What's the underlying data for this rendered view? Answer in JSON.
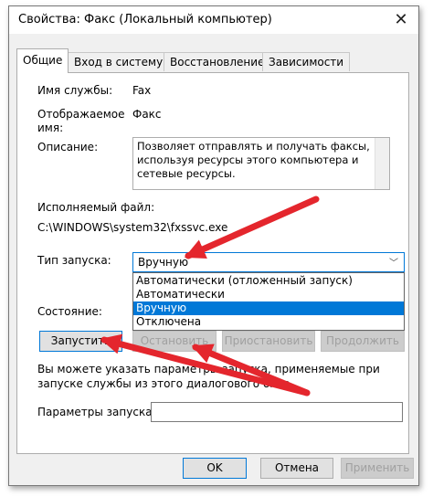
{
  "window": {
    "title": "Свойства: Факс (Локальный компьютер)"
  },
  "tabs": [
    {
      "label": "Общие",
      "active": true
    },
    {
      "label": "Вход в систему",
      "active": false
    },
    {
      "label": "Восстановление",
      "active": false
    },
    {
      "label": "Зависимости",
      "active": false
    }
  ],
  "general": {
    "service_name_label": "Имя службы:",
    "service_name_value": "Fax",
    "display_name_label_line1": "Отображаемое",
    "display_name_label_line2": "имя:",
    "display_name_value": "Факс",
    "description_label": "Описание:",
    "description_value": "Позволяет отправлять и получать факсы, используя ресурсы этого компьютера и сетевые ресурсы.",
    "exe_label": "Исполняемый файл:",
    "exe_value": "C:\\WINDOWS\\system32\\fxssvc.exe",
    "startup_type_label": "Тип запуска:",
    "startup_type_value": "Вручную",
    "startup_options": [
      "Автоматически (отложенный запуск)",
      "Автоматически",
      "Вручную",
      "Отключена"
    ],
    "startup_selected_index": 2,
    "status_label": "Состояние:",
    "buttons": {
      "start": "Запустить",
      "stop": "Остановить",
      "pause": "Приостановить",
      "resume": "Продолжить"
    },
    "note": "Вы можете указать параметры запуска, применяемые при запуске службы из этого диалогового окна.",
    "params_label": "Параметры запуска:",
    "params_value": ""
  },
  "footer": {
    "ok": "OK",
    "cancel": "Отмена",
    "apply": "Применить"
  },
  "colors": {
    "accent": "#0078d7",
    "annotation_arrow": "#e4262d"
  }
}
